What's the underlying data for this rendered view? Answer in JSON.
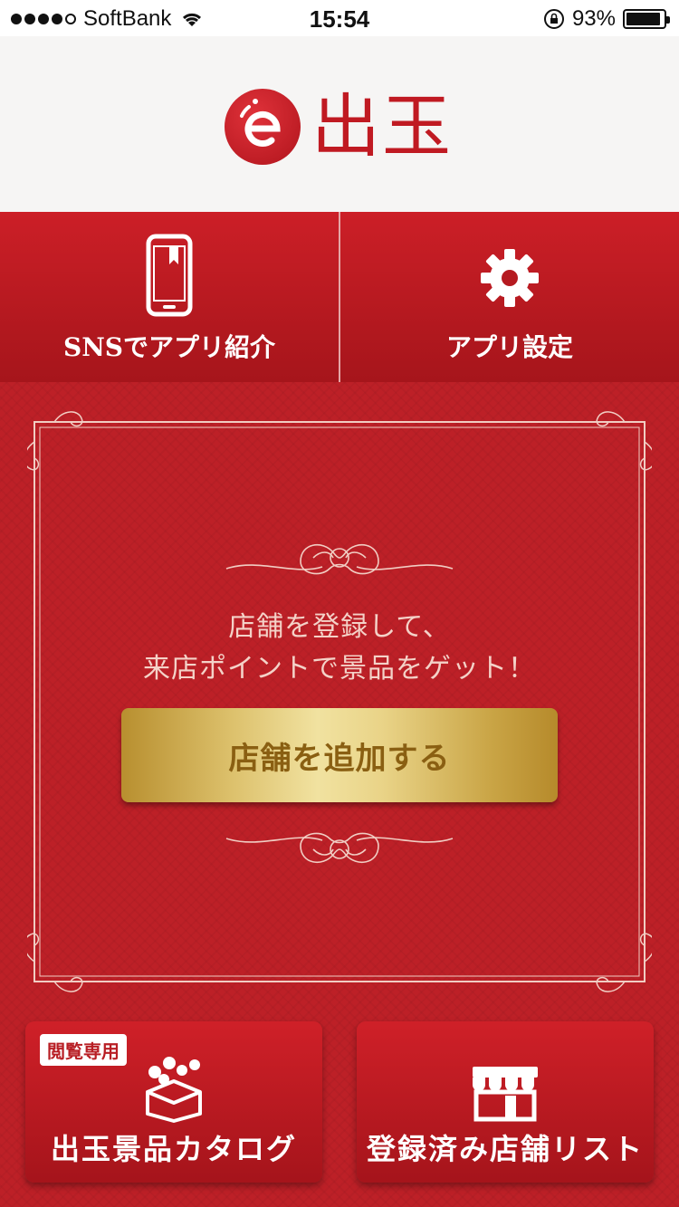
{
  "status_bar": {
    "carrier": "SoftBank",
    "time": "15:54",
    "battery": "93%",
    "battery_level": 0.93,
    "signal_bars": 4
  },
  "header": {
    "logo_text": "出玉"
  },
  "top_nav": {
    "items": [
      {
        "label": "SNSでアプリ紹介",
        "icon": "smartphone-icon"
      },
      {
        "label": "アプリ設定",
        "icon": "gear-icon"
      }
    ]
  },
  "main": {
    "promo_lines": [
      "店舗を登録して、",
      "来店ポイントで景品をゲット！"
    ],
    "cta_label": "店舗を追加する"
  },
  "tiles": [
    {
      "badge": "閲覧専用",
      "label": "出玉景品カタログ",
      "icon": "prize-box-icon"
    },
    {
      "label": "登録済み店舗リスト",
      "icon": "store-icon"
    }
  ],
  "colors": {
    "brand_red": "#c01a22",
    "gold": "#dcc06b"
  }
}
